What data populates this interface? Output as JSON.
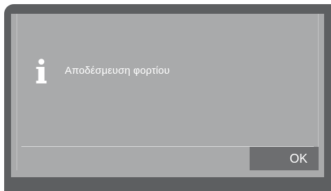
{
  "dialog": {
    "icon": "info-icon",
    "message": "Αποδέσμευση φορτίου",
    "ok_label": "OK"
  },
  "colors": {
    "bezel": "#5d5f61",
    "screen": "#a9aaab",
    "button": "#6d6e70",
    "text": "#ffffff"
  }
}
